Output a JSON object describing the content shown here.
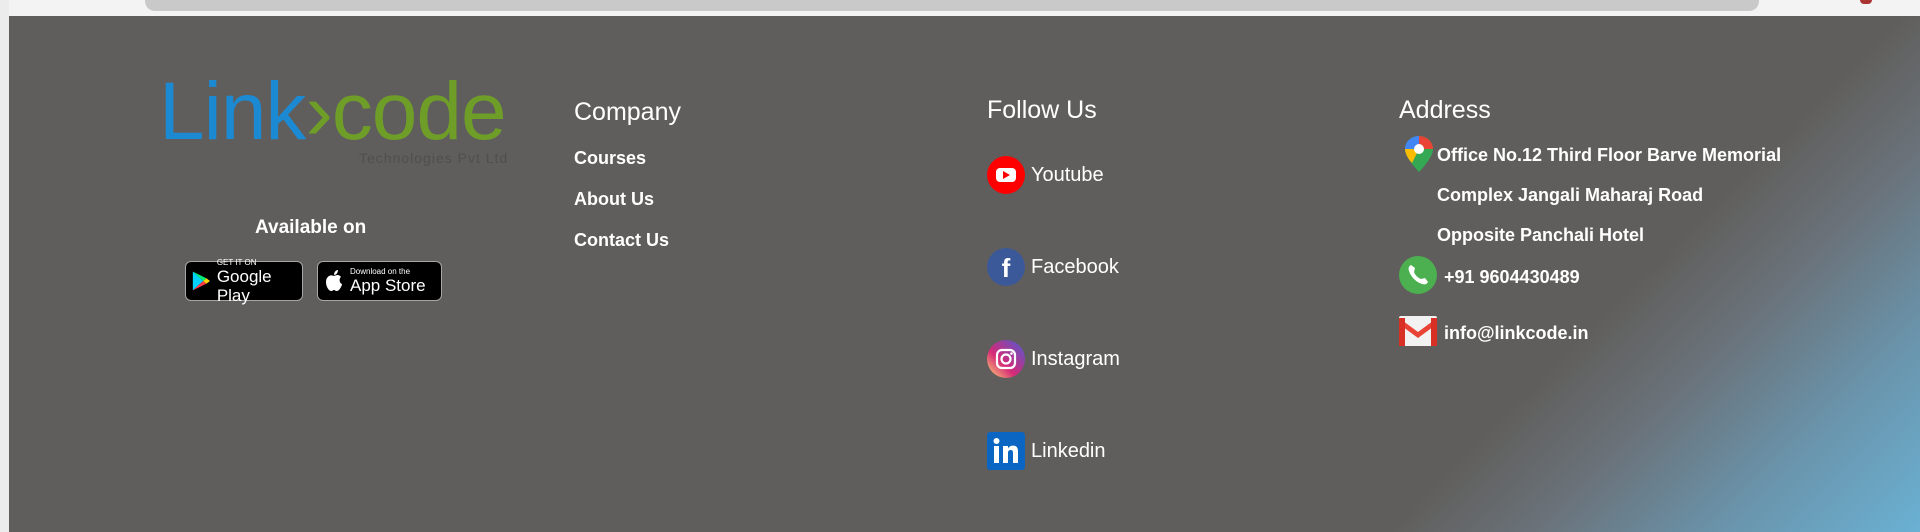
{
  "logo": {
    "part1": "Link",
    "part2": "code",
    "tagline": "Technologies Pvt Ltd"
  },
  "apps": {
    "heading": "Available on",
    "google_play": {
      "small": "GET IT ON",
      "big": "Google Play"
    },
    "app_store": {
      "small": "Download on the",
      "big": "App Store"
    }
  },
  "company": {
    "title": "Company",
    "links": [
      "Courses",
      "About Us",
      "Contact Us"
    ]
  },
  "follow": {
    "title": "Follow Us",
    "items": [
      {
        "label": "Youtube",
        "icon": "youtube-icon"
      },
      {
        "label": "Facebook",
        "icon": "facebook-icon"
      },
      {
        "label": "Instagram",
        "icon": "instagram-icon"
      },
      {
        "label": "Linkedin",
        "icon": "linkedin-icon"
      }
    ]
  },
  "address": {
    "title": "Address",
    "lines": [
      "Office No.12 Third Floor Barve Memorial",
      "Complex Jangali Maharaj Road",
      "Opposite Panchali Hotel"
    ],
    "phone": "+91 9604430489",
    "email": "info@linkcode.in"
  },
  "colors": {
    "footer_bg": "#605e5c",
    "logo_blue": "#1b8ad3",
    "logo_green": "#6e9e28"
  }
}
